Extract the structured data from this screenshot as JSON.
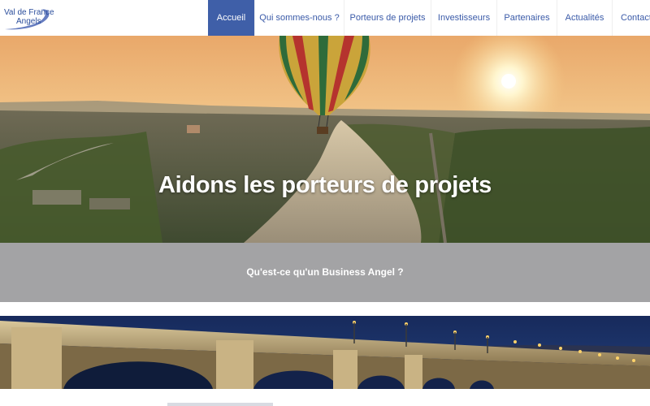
{
  "logo": {
    "line1": "Val de France",
    "line2": "Angels"
  },
  "nav": {
    "items": [
      {
        "label": "Accueil",
        "active": true
      },
      {
        "label": "Qui sommes-nous ?",
        "active": false
      },
      {
        "label": "Porteurs de projets",
        "active": false
      },
      {
        "label": "Investisseurs",
        "active": false
      },
      {
        "label": "Partenaires",
        "active": false
      },
      {
        "label": "Actualités",
        "active": false
      },
      {
        "label": "Contact",
        "active": false
      }
    ]
  },
  "hero": {
    "title": "Aidons les porteurs de projets"
  },
  "band": {
    "link": "Qu'est-ce qu'un Business Angel ?"
  },
  "colors": {
    "nav_active_bg": "#3f5fa8",
    "nav_text": "#3a5aa8",
    "band_bg": "#a3a3a5"
  }
}
